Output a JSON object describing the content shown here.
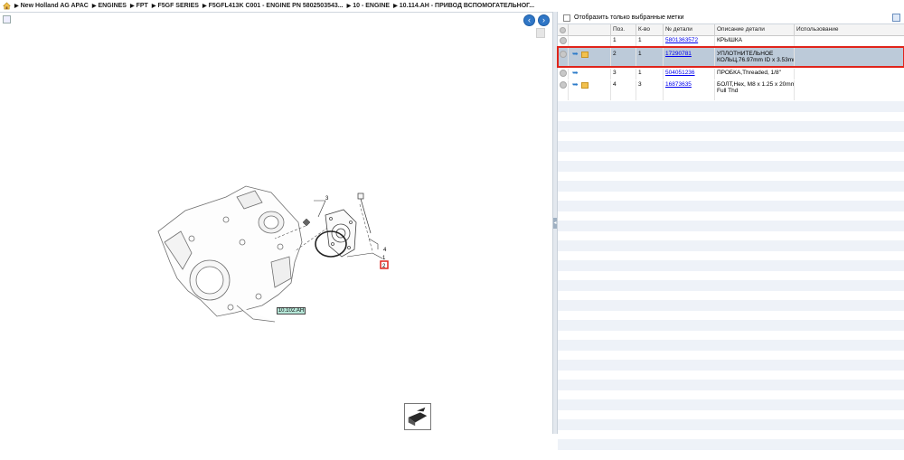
{
  "breadcrumb": {
    "items": [
      "New Holland AG APAC",
      "ENGINES",
      "FPT",
      "F5GF SERIES",
      "F5GFL413K C001 - ENGINE PN 5802503543...",
      "10 - ENGINE",
      "10.114.AH - ПРИВОД ВСПОМОГАТЕЛЬНОГ..."
    ]
  },
  "diagram": {
    "callouts": [
      "3",
      "4",
      "1",
      "2"
    ],
    "reference_label": "10.102.AH"
  },
  "filter": {
    "label": "Отобразить только выбранные метки"
  },
  "table": {
    "headers": [
      "",
      "",
      "Поз.",
      "К-во",
      "№ детали",
      "Описание детали",
      "Использование"
    ],
    "rows": [
      {
        "pos": "1",
        "qty": "1",
        "part": "5801363572",
        "desc_line1": "КРЫШКА",
        "desc_line2": "",
        "usage": "",
        "icons": [
          "circle"
        ],
        "selected": false
      },
      {
        "pos": "2",
        "qty": "1",
        "part": "17290781",
        "desc_line1": "УПЛОТНИТЕЛЬНОЕ",
        "desc_line2": "КОЛЬЦ,76.97mm ID x 3.53mm",
        "usage": "",
        "icons": [
          "circle",
          "arrow",
          "box"
        ],
        "selected": true
      },
      {
        "pos": "3",
        "qty": "1",
        "part": "504051236",
        "desc_line1": "ПРОБКА,Threaded, 1/8\"",
        "desc_line2": "",
        "usage": "",
        "icons": [
          "circle",
          "arrow"
        ],
        "selected": false
      },
      {
        "pos": "4",
        "qty": "3",
        "part": "16873635",
        "desc_line1": "БОЛТ,Hex, M8 x 1.25 x 20mm,",
        "desc_line2": "Full Thd",
        "usage": "",
        "icons": [
          "circle",
          "arrow",
          "box"
        ],
        "selected": false
      }
    ]
  },
  "colors": {
    "selection_bg": "#bccad9",
    "selection_outline": "#e0241b",
    "callout_highlight": "#e0241b",
    "reference_label_bg": "#b6e7d8",
    "nav_button": "#2f76c6"
  }
}
